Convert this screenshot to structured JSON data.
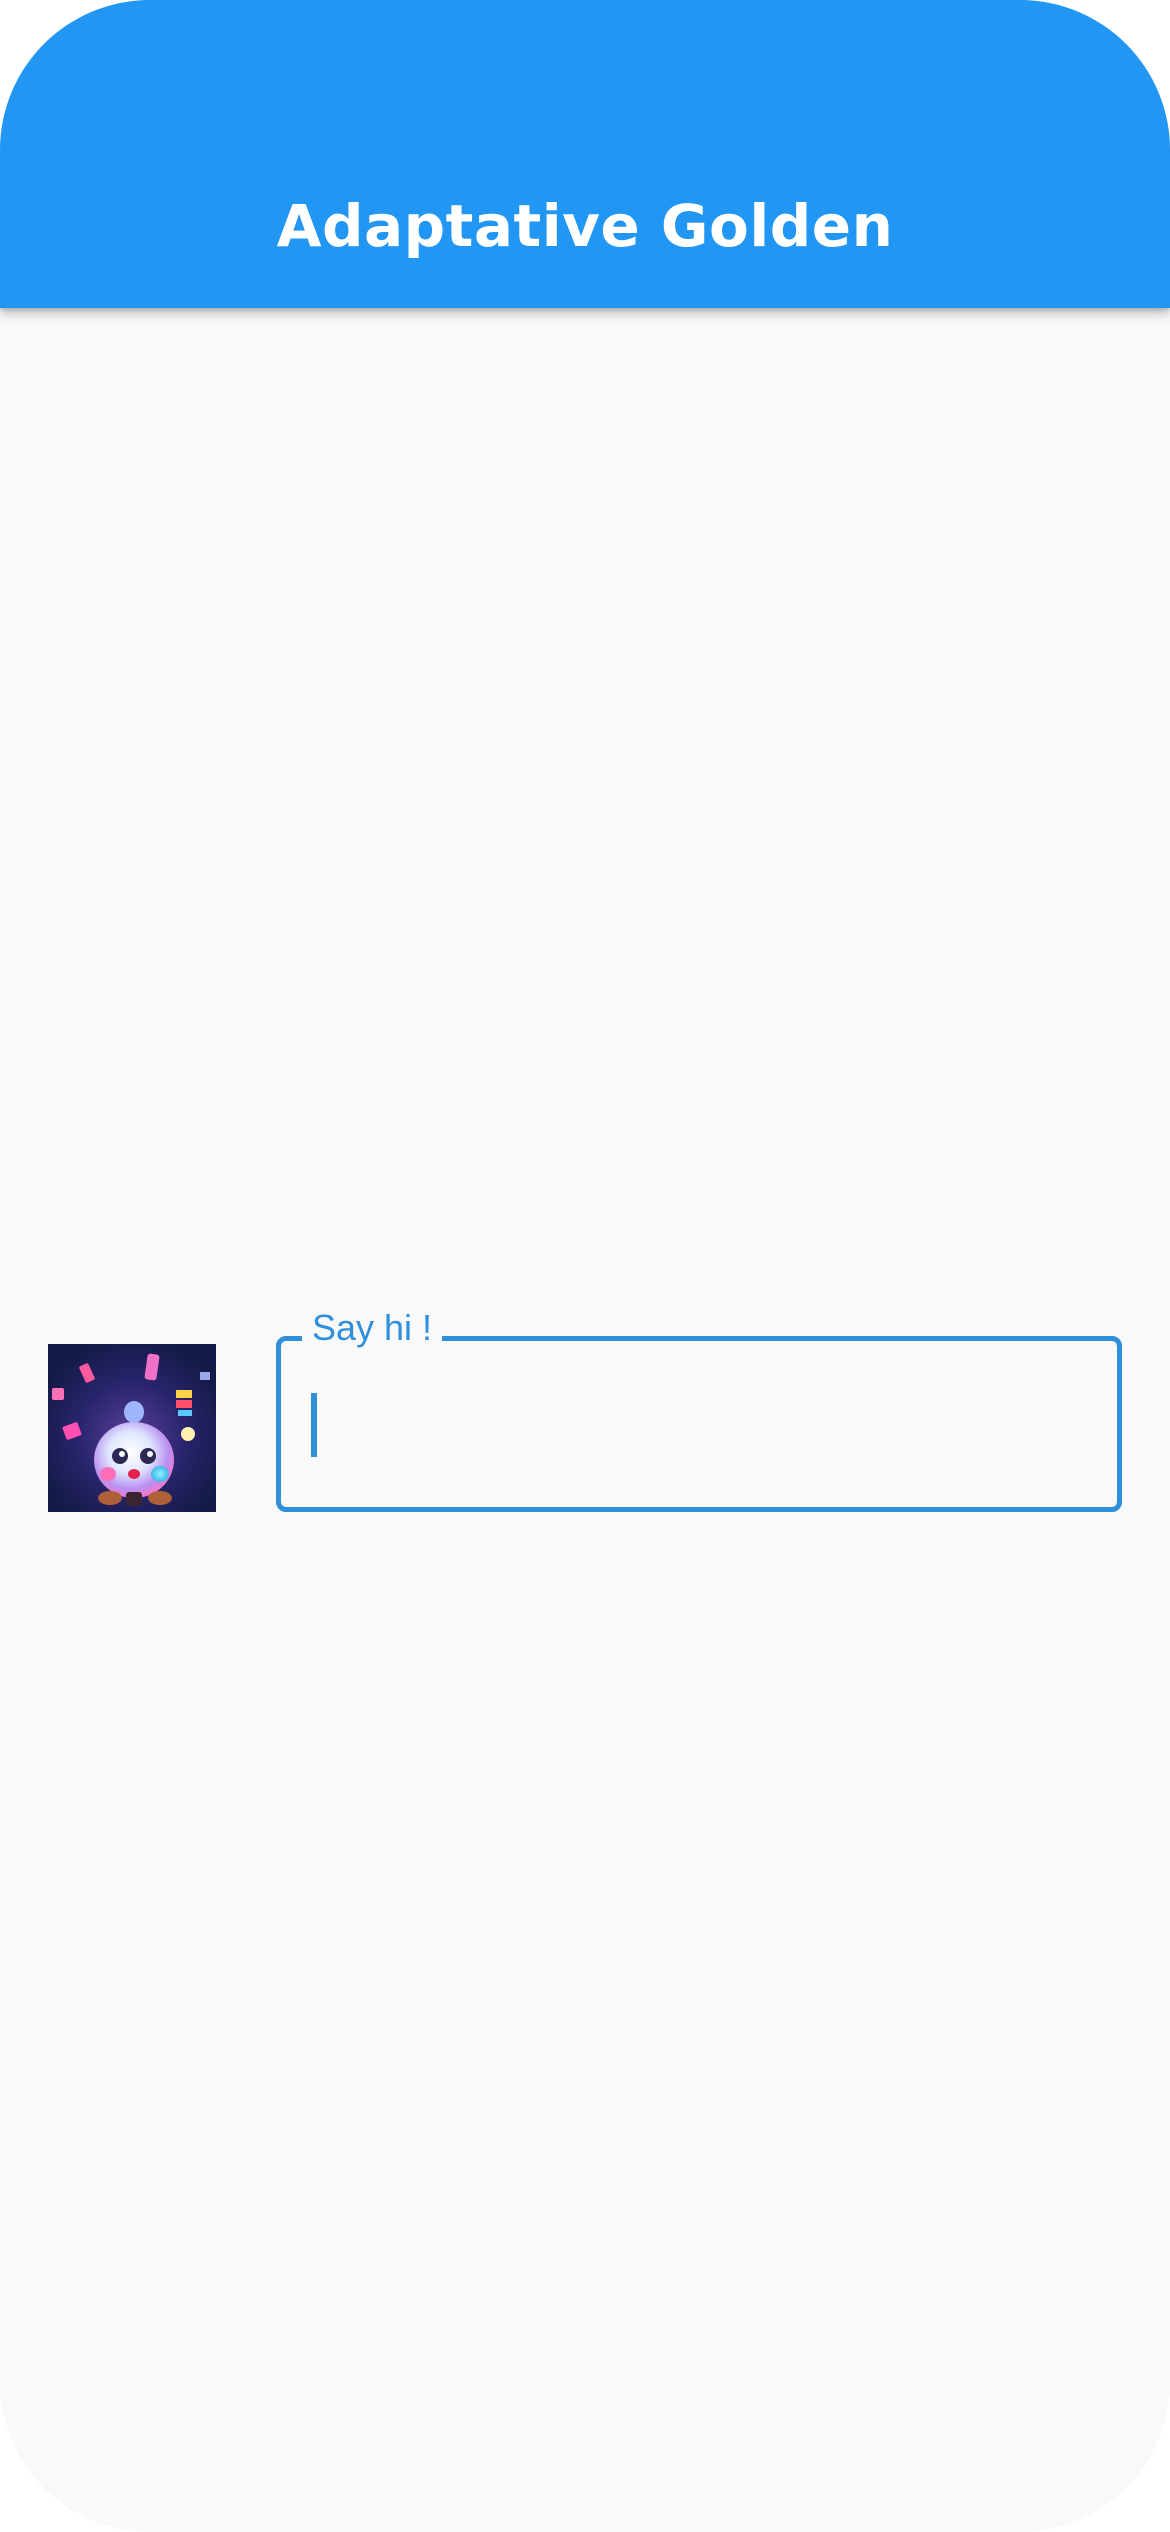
{
  "app_bar": {
    "title": "Adaptative Golden",
    "color": "#2196f3"
  },
  "form": {
    "avatar": {
      "icon": "glowing-creature-icon"
    },
    "text_field": {
      "label": "Say hi !",
      "value": "",
      "accent_color": "#2f8fdb"
    }
  },
  "background_color": "#f9f9f9"
}
